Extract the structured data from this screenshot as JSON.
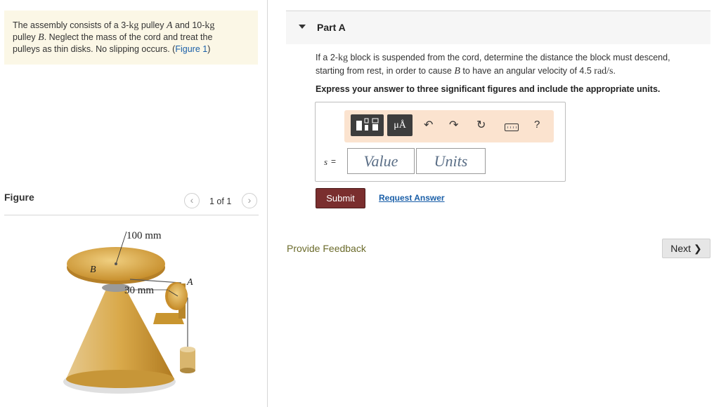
{
  "problem": {
    "s1": "The assembly consists of a 3-",
    "s2": "kg",
    "s3": " pulley ",
    "s4": "A",
    "s5": " and 10-",
    "s6": "kg",
    "s7": "pulley ",
    "s8": "B",
    "s9": ". Neglect the mass of the cord and treat the",
    "s10": "pulleys as thin disks. No slipping occurs. (",
    "link": "Figure 1",
    "s11": ")"
  },
  "figure_panel": {
    "label": "Figure",
    "prev_icon": "chevron-left-icon",
    "prev_glyph": "‹",
    "next_icon": "chevron-right-icon",
    "next_glyph": "›",
    "page_count": "1 of 1",
    "labels": {
      "radius_b": "100 mm",
      "radius_a": "30 mm",
      "pulley_a": "A",
      "pulley_b": "B"
    }
  },
  "part": {
    "title": "Part A",
    "caret_icon": "caret-down-icon"
  },
  "question": {
    "q1": "If a 2-",
    "q2": "kg",
    "q3": " block is suspended from the cord, determine the distance the block must descend,",
    "q4": "starting from rest, in order to cause ",
    "q5": "B",
    "q6": " to have an angular velocity of 4.5 ",
    "q7": "rad/s",
    "q8": ".",
    "instruction": "Express your answer to three significant figures and include the appropriate units."
  },
  "toolbar": {
    "units_label": "μÅ",
    "undo_glyph": "↶",
    "redo_glyph": "↷",
    "reset_glyph": "↻",
    "help_glyph": "?",
    "icons": [
      "templates-icon",
      "units-icon",
      "undo-icon",
      "redo-icon",
      "reset-icon",
      "keyboard-icon",
      "help-icon"
    ]
  },
  "answer": {
    "variable": "s",
    "equals": "=",
    "value_placeholder": "Value",
    "units_placeholder": "Units"
  },
  "actions": {
    "submit_label": "Submit",
    "request_label": "Request Answer",
    "feedback_label": "Provide Feedback",
    "next_label": "Next",
    "next_glyph": "❯"
  },
  "colors": {
    "problem_bg": "#fbf7e6",
    "toolbar_bg": "#fbe3cf",
    "submit_bg": "#7a2e2e",
    "link": "#1a5fa8",
    "feedback": "#6b6b2b",
    "pulley_gold": "#d9a94a"
  }
}
